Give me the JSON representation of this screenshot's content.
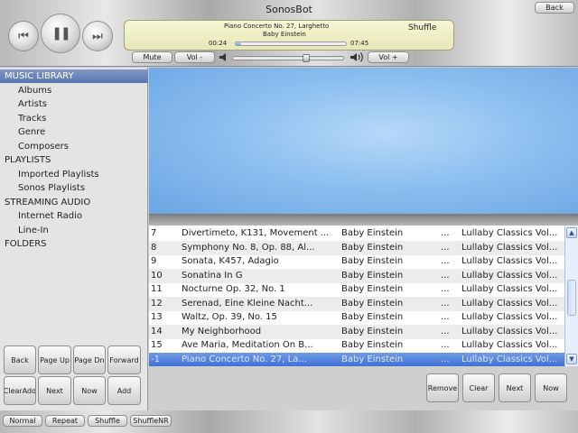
{
  "app": {
    "title": "SonosBot",
    "back_label": "Back"
  },
  "transport": {
    "prev_glyph": "⏮",
    "play_pause_glyph": "❚❚",
    "next_glyph": "⏭"
  },
  "now_playing": {
    "track": "Piano Concerto No. 27, Larghetto",
    "artist": "Baby Einstein",
    "shuffle_label": "Shuffle",
    "elapsed": "00:24",
    "duration": "07:45",
    "progress_fraction": 0.05
  },
  "volume": {
    "mute_label": "Mute",
    "vol_down_label": "Vol -",
    "vol_up_label": "Vol +",
    "level_fraction": 0.66
  },
  "sidebar": {
    "items": [
      {
        "label": "MUSIC LIBRARY",
        "level": "section",
        "selected": true
      },
      {
        "label": "Albums",
        "level": "child"
      },
      {
        "label": "Artists",
        "level": "child"
      },
      {
        "label": "Tracks",
        "level": "child"
      },
      {
        "label": "Genre",
        "level": "child"
      },
      {
        "label": "Composers",
        "level": "child"
      },
      {
        "label": "PLAYLISTS",
        "level": "section"
      },
      {
        "label": "Imported Playlists",
        "level": "child"
      },
      {
        "label": "Sonos Playlists",
        "level": "child"
      },
      {
        "label": "STREAMING AUDIO",
        "level": "section"
      },
      {
        "label": "Internet Radio",
        "level": "child"
      },
      {
        "label": "Line-In",
        "level": "child"
      },
      {
        "label": "FOLDERS",
        "level": "section"
      }
    ],
    "buttons": {
      "back": "Back",
      "page_up": "Page Up",
      "page_down": "Page Dn",
      "forward": "Forward",
      "clear_add": "ClearAdd",
      "next": "Next",
      "now": "Now",
      "add": "Add"
    }
  },
  "queue": {
    "rows": [
      {
        "num": "7",
        "title": "Divertimeto, K131, Movement ...",
        "artist": "Baby Einstein",
        "ellipsis": "...",
        "album": "Lullaby Classics Vol..."
      },
      {
        "num": "8",
        "title": "Symphony No. 8, Op. 88, Al...",
        "artist": "Baby Einstein",
        "ellipsis": "...",
        "album": "Lullaby Classics Vol..."
      },
      {
        "num": "9",
        "title": "Sonata, K457, Adagio",
        "artist": "Baby Einstein",
        "ellipsis": "...",
        "album": "Lullaby Classics Vol..."
      },
      {
        "num": "10",
        "title": "Sonatina In G",
        "artist": "Baby Einstein",
        "ellipsis": "...",
        "album": "Lullaby Classics Vol..."
      },
      {
        "num": "11",
        "title": "Nocturne Op. 32, No. 1",
        "artist": "Baby Einstein",
        "ellipsis": "...",
        "album": "Lullaby Classics Vol..."
      },
      {
        "num": "12",
        "title": "Serenad, Eine Kleine Nacht...",
        "artist": "Baby Einstein",
        "ellipsis": "...",
        "album": "Lullaby Classics Vol..."
      },
      {
        "num": "13",
        "title": "Waltz, Op. 39, No. 15",
        "artist": "Baby Einstein",
        "ellipsis": "...",
        "album": "Lullaby Classics Vol..."
      },
      {
        "num": "14",
        "title": "My Neighborhood",
        "artist": "Baby Einstein",
        "ellipsis": "...",
        "album": "Lullaby Classics Vol..."
      },
      {
        "num": "15",
        "title": "Ave Maria, Meditation On B...",
        "artist": "Baby Einstein",
        "ellipsis": "...",
        "album": "Lullaby Classics Vol..."
      },
      {
        "num": "-1",
        "title": "Piano Concerto No. 27, La...",
        "artist": "Baby Einstein",
        "ellipsis": "...",
        "album": "Lullaby Classics Vol...",
        "current": true
      }
    ],
    "buttons": {
      "remove": "Remove",
      "clear": "Clear",
      "next": "Next",
      "now": "Now"
    }
  },
  "play_modes": {
    "normal": "Normal",
    "repeat": "Repeat",
    "shuffle": "Shuffle",
    "shuffle_nr": "ShuffleNR"
  },
  "colors": {
    "selection": "#5b77b1",
    "current_track": "#3b6fd6",
    "now_playing_panel": "#e7e7b8",
    "art_area": "#8ec0f0"
  }
}
